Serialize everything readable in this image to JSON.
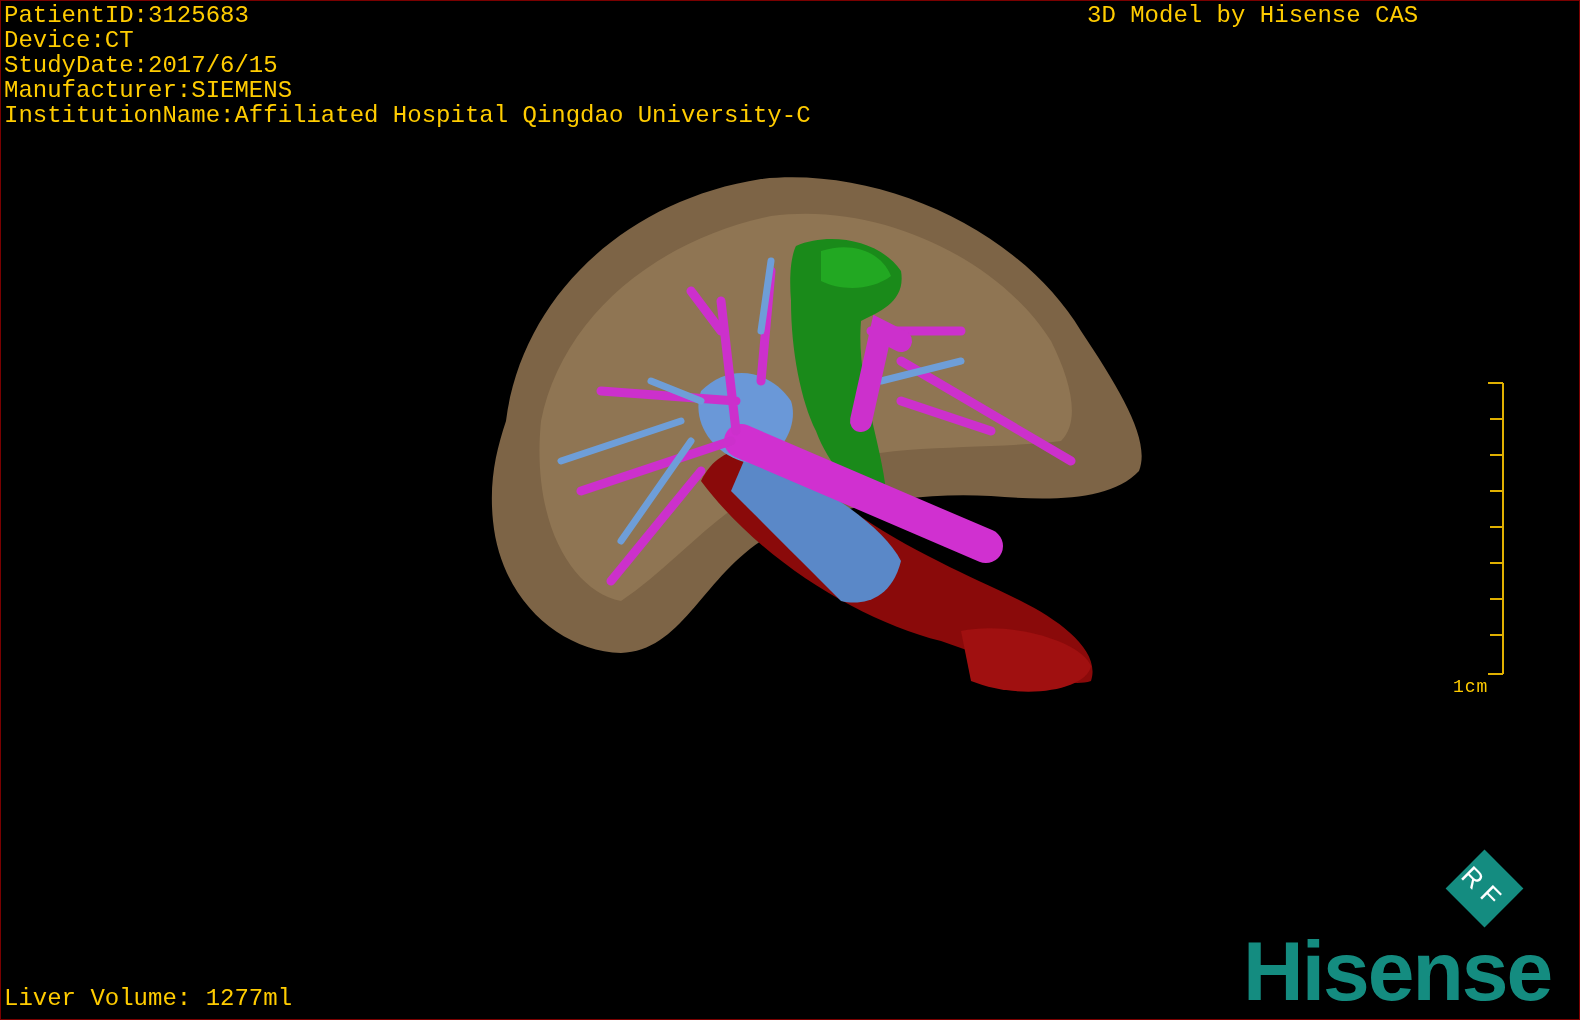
{
  "info_lines": [
    "PatientID:3125683",
    "Device:CT",
    "StudyDate:2017/6/15",
    "Manufacturer:SIEMENS",
    "InstitutionName:Affiliated Hospital Qingdao University-C"
  ],
  "title": "3D Model by Hisense CAS",
  "scale_bar": {
    "label": "1cm"
  },
  "volume": "Liver Volume: 1277ml",
  "logo": {
    "mark": "RF",
    "wordmark": "Hisense"
  }
}
